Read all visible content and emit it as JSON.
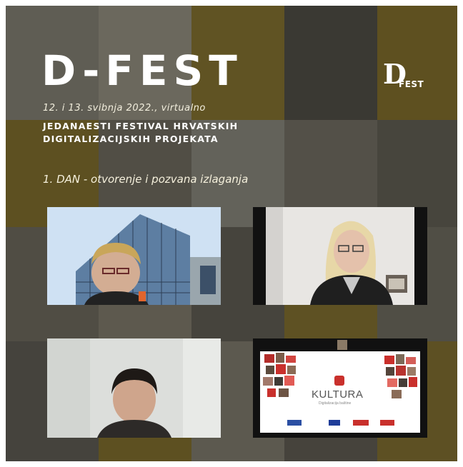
{
  "poster": {
    "title": "D-FEST",
    "date": "12. i 13. svibnja 2022., virtualno",
    "subtitle_line1": "JEDANAESTI FESTIVAL HRVATSKIH",
    "subtitle_line2": "DIGITALIZACIJSKIH PROJEKATA",
    "day_label": "1. DAN - otvorenje i pozvana izlaganja",
    "logo_letter": "D",
    "logo_word": "FEST"
  },
  "slide": {
    "brand": "KULTURA",
    "tagline": "Digitalizacija baštine"
  },
  "colors": {
    "olive": "#6b5a20",
    "text": "#ffffff",
    "accent_red": "#c9302c"
  }
}
